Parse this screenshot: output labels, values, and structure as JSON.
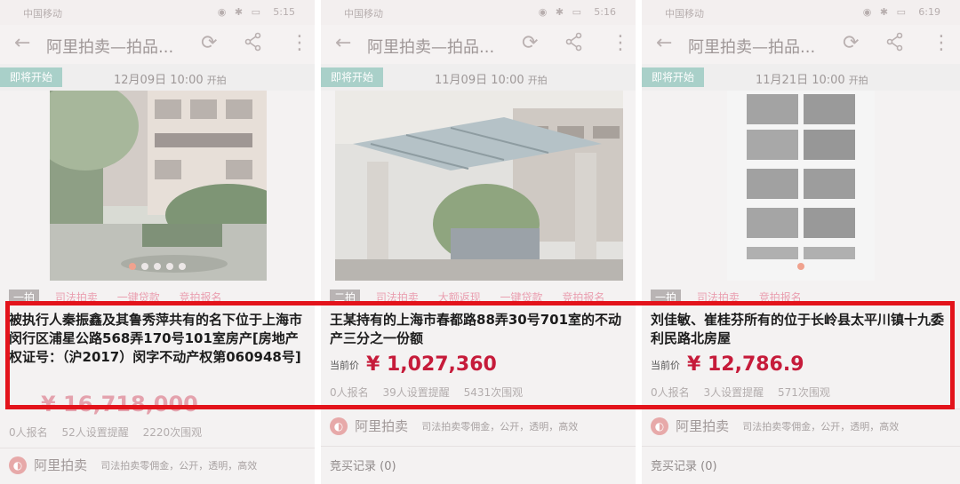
{
  "highlight_color": "#e3131b",
  "panels": [
    {
      "status": {
        "carrier": "中国移动",
        "time": "5:15"
      },
      "title": "阿里拍卖—拍品...",
      "countdown": {
        "badge": "即将开始",
        "date_time": "12月09日 10:00",
        "suffix": "开拍"
      },
      "photo_dots": {
        "count": 5,
        "active": 1
      },
      "tags": [
        "一拍",
        "司法拍卖",
        "一键贷款",
        "竞拍报名"
      ],
      "item_title": "被执行人秦振鑫及其鲁秀萍共有的名下位于上海市闵行区浦星公路568弄170号101室房产[房地产权证号：（沪2017）闵字不动产权第060948号]",
      "price_value": "¥ 16,718,000",
      "stats": [
        "0人报名",
        "52人设置提醒",
        "2220次围观"
      ],
      "brand": {
        "name": "阿里拍卖",
        "slogan": "司法拍卖零佣金，公开，透明，高效"
      }
    },
    {
      "status": {
        "carrier": "中国移动",
        "time": "5:16"
      },
      "title": "阿里拍卖—拍品...",
      "countdown": {
        "badge": "即将开始",
        "date_time": "11月09日 10:00",
        "suffix": "开拍"
      },
      "tags": [
        "二拍",
        "司法拍卖",
        "大额返现",
        "一键贷款",
        "竞拍报名"
      ],
      "item_title": "王某持有的上海市春都路88弄30号701室的不动产三分之一份额",
      "price_label": "当前价",
      "price_value": "¥ 1,027,360",
      "stats": [
        "0人报名",
        "39人设置提醒",
        "5431次围观"
      ],
      "brand": {
        "name": "阿里拍卖",
        "slogan": "司法拍卖零佣金，公开，透明，高效"
      },
      "records": "竞买记录 (0)"
    },
    {
      "status": {
        "carrier": "中国移动",
        "time": "6:19"
      },
      "title": "阿里拍卖—拍品...",
      "countdown": {
        "badge": "即将开始",
        "date_time": "11月21日 10:00",
        "suffix": "开拍"
      },
      "photo_dots": {
        "count": 1,
        "active": 0
      },
      "tags": [
        "一拍",
        "司法拍卖",
        "竞拍报名"
      ],
      "item_title": "刘佳敏、崔桂芬所有的位于长岭县太平川镇十九委利民路北房屋",
      "price_label": "当前价",
      "price_value": "¥ 12,786.9",
      "stats": [
        "0人报名",
        "3人设置提醒",
        "571次围观"
      ],
      "brand": {
        "name": "阿里拍卖",
        "slogan": "司法拍卖零佣金，公开，透明，高效"
      },
      "records": "竞买记录 (0)"
    }
  ]
}
